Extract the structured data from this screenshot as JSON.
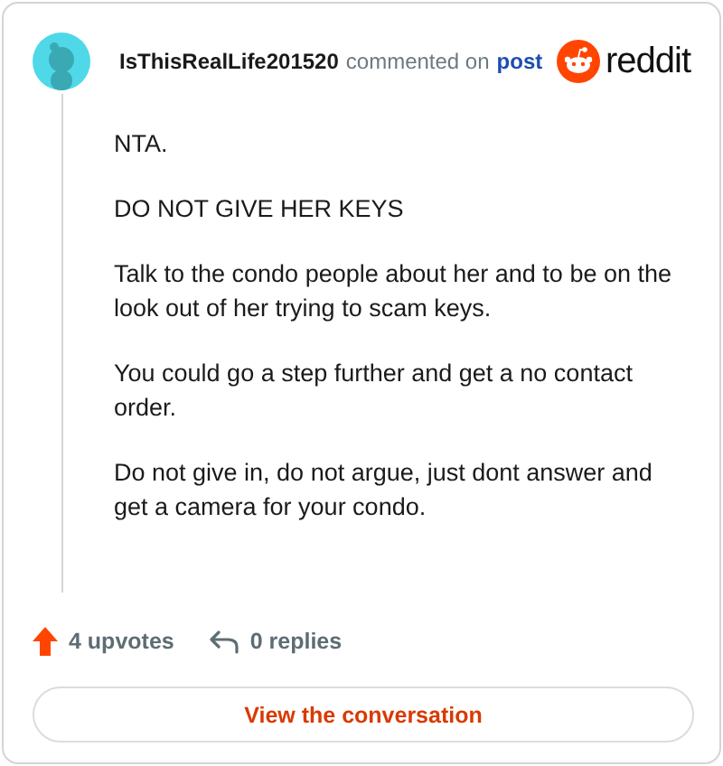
{
  "header": {
    "username": "IsThisRealLife201520",
    "action": "commented on",
    "link": "post",
    "brand": "reddit"
  },
  "comment": {
    "paragraphs": [
      "NTA.",
      "DO NOT GIVE HER KEYS",
      "Talk to the condo people about her and to be on the look out of her trying to scam keys.",
      "You could go a step further and get a no contact order.",
      "Do not give in, do not argue, just dont answer and get a camera for your condo."
    ]
  },
  "footer": {
    "upvotes": "4 upvotes",
    "replies": "0 replies"
  },
  "button": {
    "label": "View the conversation"
  }
}
